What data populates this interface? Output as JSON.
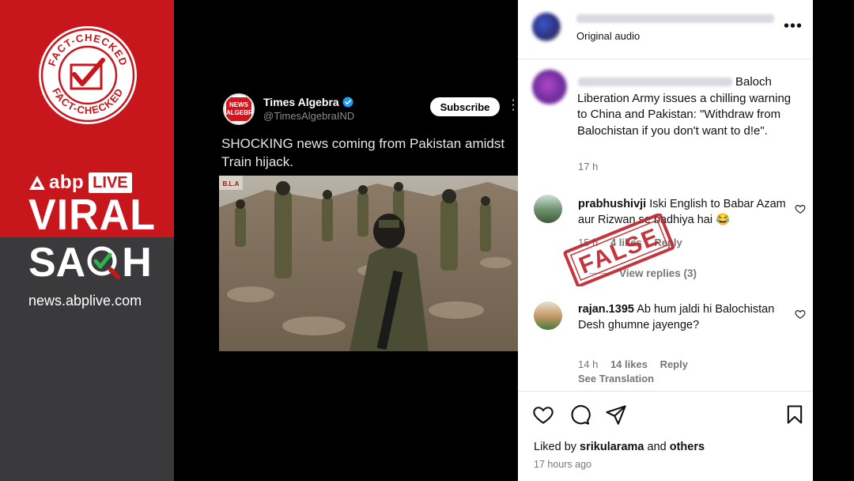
{
  "brand": {
    "stamp_top_text": "FACT-CHECKED",
    "stamp_bottom_text": "FACT-CHECKED",
    "abp_text": "abp",
    "live_text": "LIVE",
    "viral_text": "VIRAL",
    "sach_prefix": "SA",
    "sach_suffix": "H",
    "site_url": "news.abplive.com",
    "colors": {
      "red": "#c8161d",
      "dark": "#3a3a3c"
    }
  },
  "tweet": {
    "author_name": "Times Algebra",
    "author_handle": "@TimesAlgebraIND",
    "avatar_text": "NEWS ALGEBRA",
    "subscribe_label": "Subscribe",
    "text": "SHOCKING news coming from Pakistan amidst Train hijack.",
    "media_badge": "B.L.A"
  },
  "instagram": {
    "header_subtitle": "Original audio",
    "more_icon": "more-horizontal-icon",
    "caption": "Baloch Liberation Army issues a chilling warning to China and Pakistan: \"Withdraw from Balochistan if you don't want to d!e\".",
    "caption_time": "17 h",
    "comments": [
      {
        "user": "prabhushivji",
        "text": "Iski English to Babar Azam aur Rizwan se badhiya hai 😂",
        "time": "15 h",
        "likes": "4 likes",
        "reply_label": "Reply",
        "view_replies": "View replies (3)"
      },
      {
        "user": "rajan.1395",
        "text": "Ab hum jaldi hi Balochistan Desh ghumne jayenge?",
        "time": "14 h",
        "likes": "14 likes",
        "reply_label": "Reply",
        "see_translation": "See Translation"
      }
    ],
    "false_stamp_text": "FALSE",
    "liked_by_prefix": "Liked by",
    "liked_by_user": "srikularama",
    "liked_by_and": "and",
    "liked_by_others": "others",
    "post_time": "17 hours ago",
    "colors": {
      "stamp": "#c0262d"
    }
  }
}
